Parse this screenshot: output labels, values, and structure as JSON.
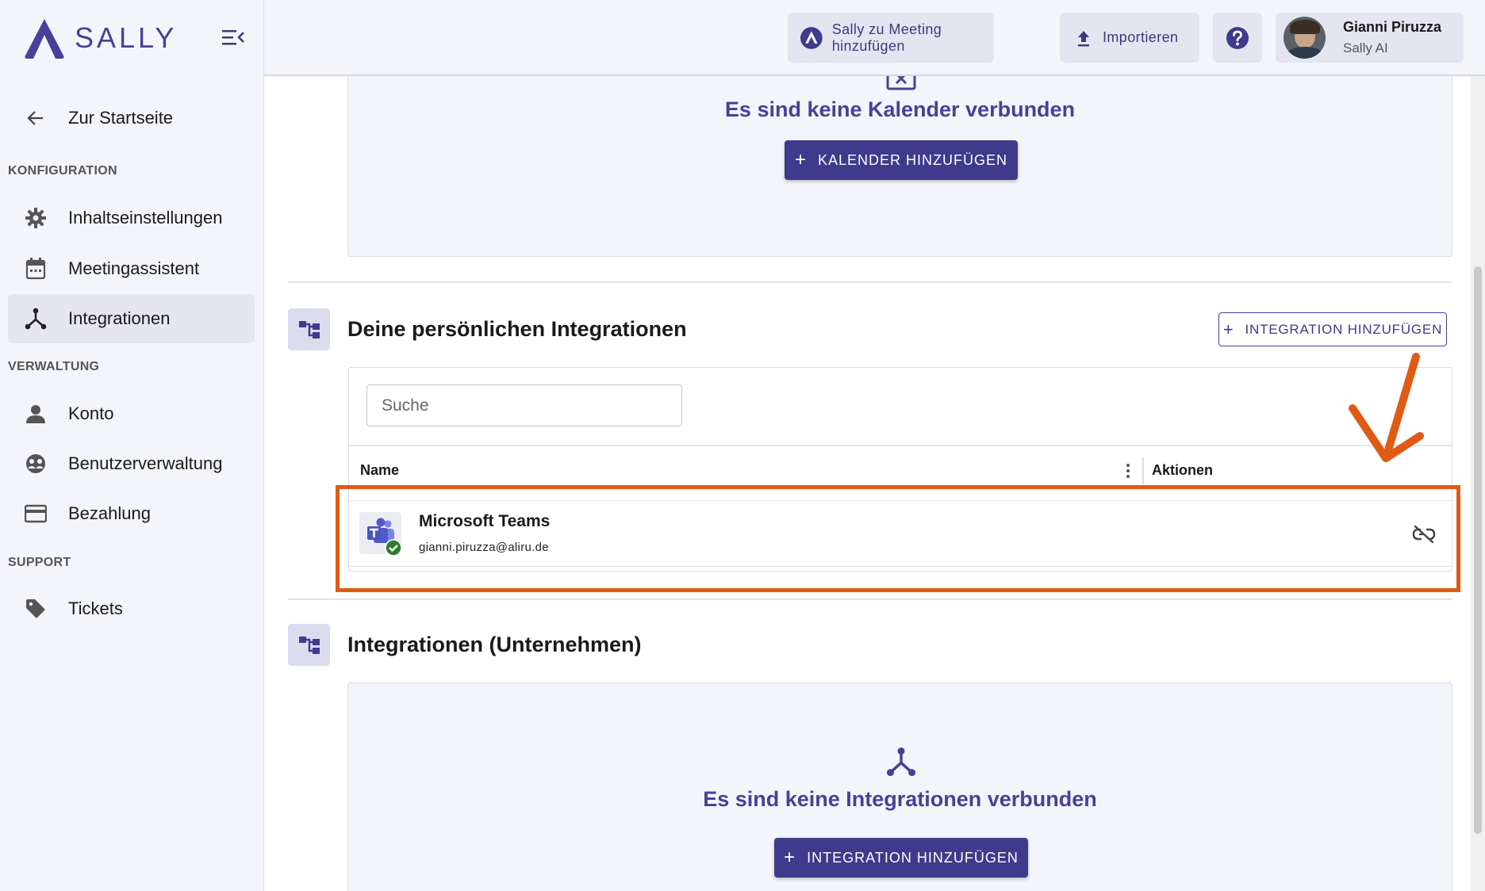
{
  "brand": {
    "name": "SALLY"
  },
  "sidebar": {
    "back_label": "Zur Startseite",
    "sections": {
      "config": "KONFIGURATION",
      "admin": "VERWALTUNG",
      "support": "SUPPORT"
    },
    "items": {
      "content": "Inhaltseinstellungen",
      "meeting": "Meetingassistent",
      "integrations": "Integrationen",
      "account": "Konto",
      "users": "Benutzerverwaltung",
      "billing": "Bezahlung",
      "tickets": "Tickets"
    }
  },
  "header": {
    "add_to_meeting": "Sally zu Meeting hinzufügen",
    "import": "Importieren",
    "user": {
      "name": "Gianni Piruzza",
      "org": "Sally AI"
    }
  },
  "calendar": {
    "empty_title": "Es sind keine Kalender verbunden",
    "add_button": "KALENDER HINZUFÜGEN"
  },
  "personal_integrations": {
    "title": "Deine persönlichen Integrationen",
    "add_button": "INTEGRATION HINZUFÜGEN",
    "search_placeholder": "Suche",
    "columns": {
      "name": "Name",
      "actions": "Aktionen"
    },
    "rows": [
      {
        "name": "Microsoft Teams",
        "account": "gianni.piruzza@aliru.de"
      }
    ]
  },
  "company_integrations": {
    "title": "Integrationen (Unternehmen)",
    "empty_title": "Es sind keine Integrationen verbunden",
    "add_button": "INTEGRATION HINZUFÜGEN"
  },
  "colors": {
    "primary": "#3e3a8c",
    "accent_text": "#4a3f9a",
    "highlight": "#e05a14"
  }
}
